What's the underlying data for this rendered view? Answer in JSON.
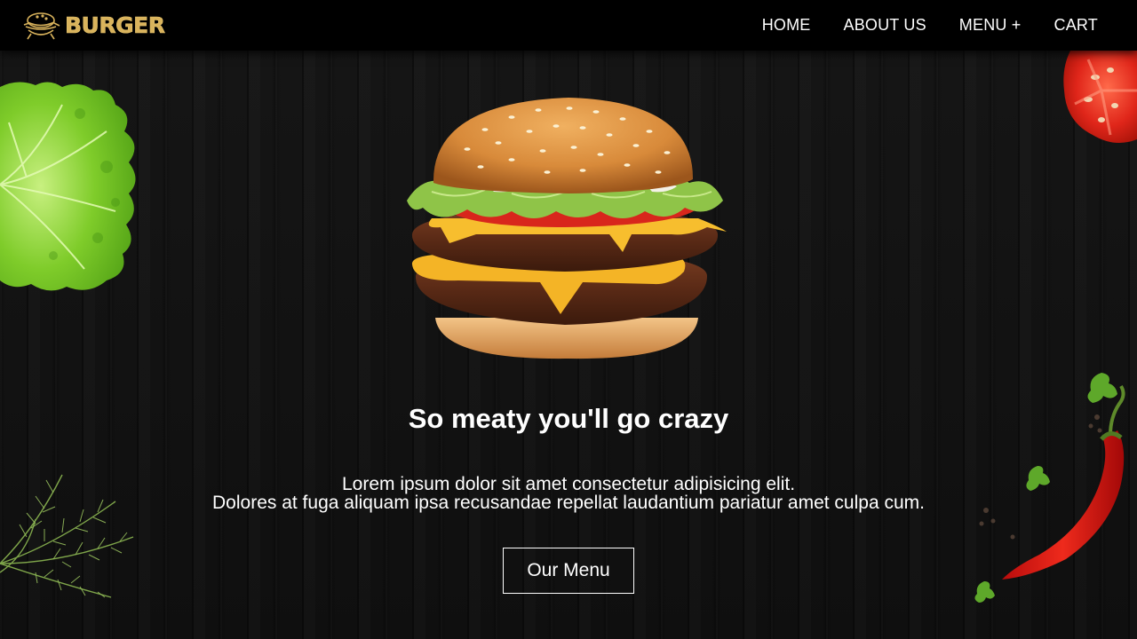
{
  "brand": {
    "name": "BURGER",
    "logo_icon": "burger-logo-icon",
    "color": "#d9b35c"
  },
  "nav": {
    "items": [
      {
        "label": "HOME"
      },
      {
        "label": "ABOUT US"
      },
      {
        "label": "MENU +"
      },
      {
        "label": "CART"
      }
    ]
  },
  "hero": {
    "image": "burger-image",
    "title": "So meaty you'll go crazy",
    "description_line1": "Lorem ipsum dolor sit amet consectetur adipisicing elit.",
    "description_line2": "Dolores at fuga aliquam ipsa recusandae repellat laudantium pariatur amet culpa cum.",
    "cta_label": "Our Menu"
  },
  "decorations": [
    "lettuce-image",
    "tomato-image",
    "dill-image",
    "chili-pepper-image"
  ]
}
